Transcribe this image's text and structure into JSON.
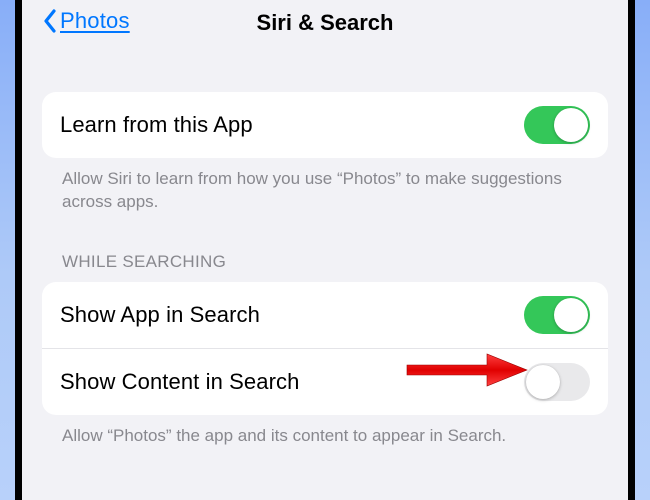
{
  "nav": {
    "back_label": "Photos",
    "title": "Siri & Search"
  },
  "group1": {
    "rows": [
      {
        "label": "Learn from this App",
        "on": true
      }
    ],
    "footer": "Allow Siri to learn from how you use “Photos” to make suggestions across apps."
  },
  "section2_header": "WHILE SEARCHING",
  "group2": {
    "rows": [
      {
        "label": "Show App in Search",
        "on": true
      },
      {
        "label": "Show Content in Search",
        "on": false
      }
    ],
    "footer": "Allow “Photos” the app and its content to appear in Search."
  },
  "colors": {
    "tint": "#0077ff",
    "toggle_on": "#34c759",
    "toggle_off": "#e9e9eb",
    "arrow": "#ff0000"
  }
}
